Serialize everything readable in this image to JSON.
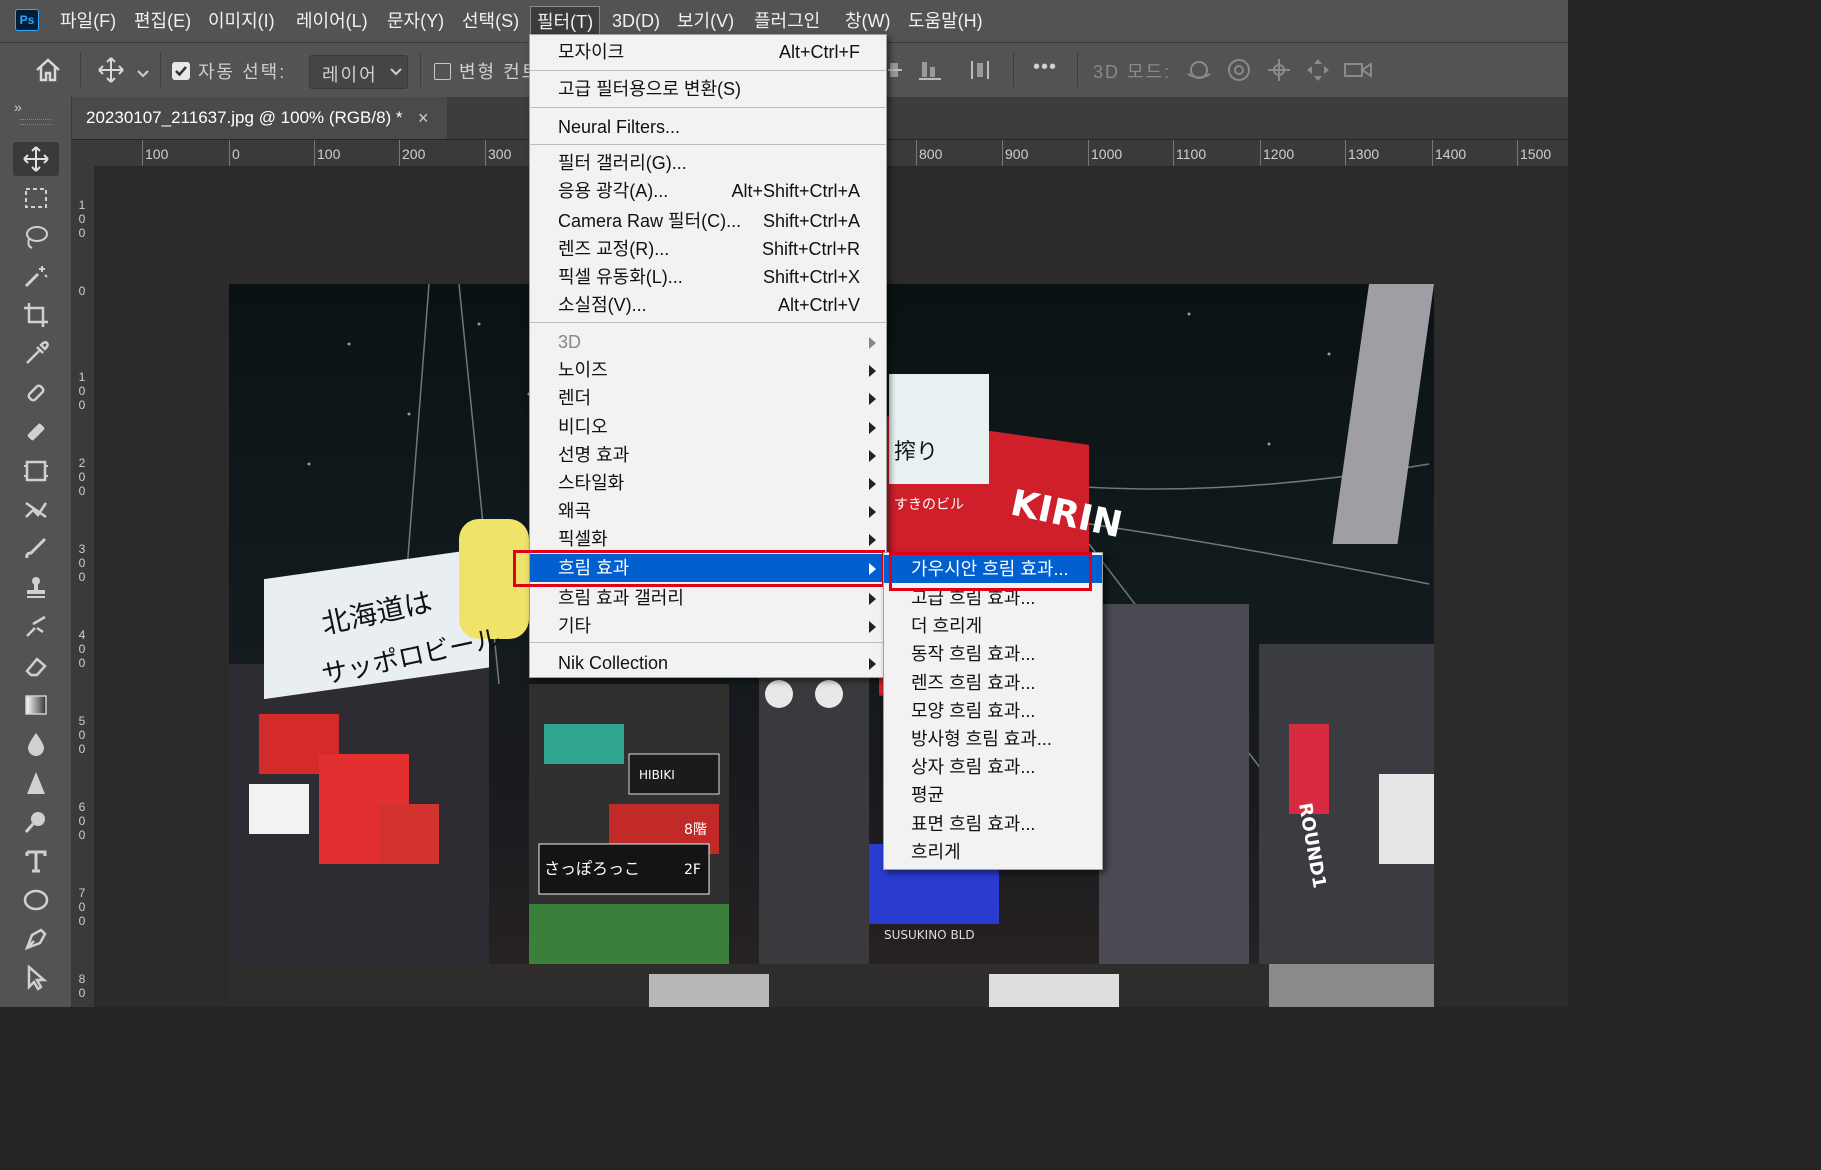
{
  "app": {
    "logo": "Ps"
  },
  "menubar": {
    "items": [
      "파일(F)",
      "편집(E)",
      "이미지(I)",
      "레이어(L)",
      "문자(Y)",
      "선택(S)",
      "필터(T)",
      "3D(D)",
      "보기(V)",
      "플러그인",
      "창(W)",
      "도움말(H)"
    ]
  },
  "options": {
    "auto_select_label": "자동 선택:",
    "auto_select_value": "레이어",
    "transform_label": "변형 컨트",
    "mode_3d_label": "3D 모드:",
    "more": "•••"
  },
  "document": {
    "tab_title": "20230107_211637.jpg @ 100% (RGB/8) *",
    "close_glyph": "×"
  },
  "rulers": {
    "top": [
      "100",
      "0",
      "100",
      "200",
      "300",
      "800",
      "900",
      "1000",
      "1100",
      "1200",
      "1300",
      "1400",
      "1500"
    ],
    "left": [
      "100",
      "0",
      "100",
      "200",
      "300",
      "400",
      "500",
      "600",
      "700",
      "80"
    ]
  },
  "filter_menu": {
    "items": [
      {
        "label": "모자이크",
        "shortcut": "Alt+Ctrl+F"
      },
      {
        "label": "고급 필터용으로 변환(S)",
        "shortcut": ""
      },
      {
        "label": "Neural Filters...",
        "shortcut": ""
      },
      {
        "label": "필터 갤러리(G)...",
        "shortcut": ""
      },
      {
        "label": "응용 광각(A)...",
        "shortcut": "Alt+Shift+Ctrl+A"
      },
      {
        "label": "Camera Raw 필터(C)...",
        "shortcut": "Shift+Ctrl+A"
      },
      {
        "label": "렌즈 교정(R)...",
        "shortcut": "Shift+Ctrl+R"
      },
      {
        "label": "픽셀 유동화(L)...",
        "shortcut": "Shift+Ctrl+X"
      },
      {
        "label": "소실점(V)...",
        "shortcut": "Alt+Ctrl+V"
      },
      {
        "label": "3D",
        "shortcut": ""
      },
      {
        "label": "노이즈",
        "shortcut": ""
      },
      {
        "label": "렌더",
        "shortcut": ""
      },
      {
        "label": "비디오",
        "shortcut": ""
      },
      {
        "label": "선명 효과",
        "shortcut": ""
      },
      {
        "label": "스타일화",
        "shortcut": ""
      },
      {
        "label": "왜곡",
        "shortcut": ""
      },
      {
        "label": "픽셀화",
        "shortcut": ""
      },
      {
        "label": "흐림 효과",
        "shortcut": ""
      },
      {
        "label": "흐림 효과 갤러리",
        "shortcut": ""
      },
      {
        "label": "기타",
        "shortcut": ""
      },
      {
        "label": "Nik Collection",
        "shortcut": ""
      }
    ]
  },
  "blur_submenu": {
    "items": [
      "가우시안 흐림 효과...",
      "고급 흐림 효과...",
      "더 흐리게",
      "동작 흐림 효과...",
      "렌즈 흐림 효과...",
      "모양 흐림 효과...",
      "방사형 흐림 효과...",
      "상자 흐림 효과...",
      "평균",
      "표면 흐림 효과...",
      "흐리게"
    ]
  },
  "photo": {
    "signs": [
      "北海道は",
      "サッポロビール",
      "KIRIN",
      "ROUND1",
      "SUSUKINO BLD",
      "HIBIKI",
      "8階",
      "2F",
      "さっぽろっこ",
      "搾り",
      "すきのビル"
    ]
  },
  "colors": {
    "menu_highlight": "#0060d0",
    "annotation_red": "#e0001a",
    "menubar_bg": "#535353"
  }
}
